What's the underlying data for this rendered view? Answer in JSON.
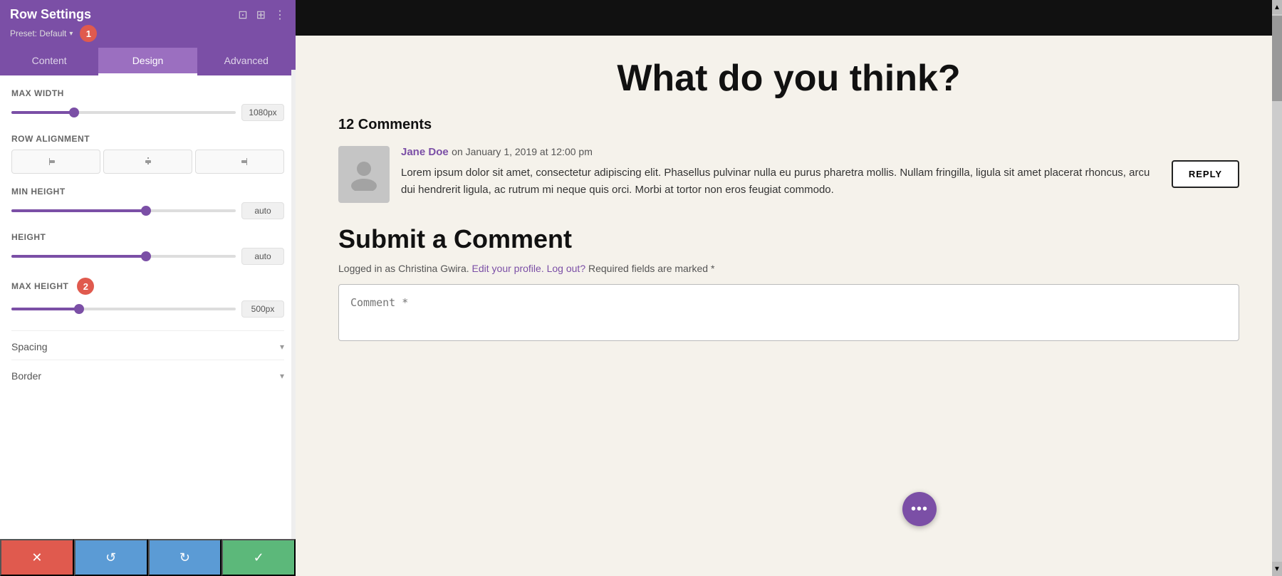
{
  "panel": {
    "title": "Row Settings",
    "preset_label": "Preset: Default",
    "preset_arrow": "▾",
    "badge1": "1",
    "badge2": "2",
    "tabs": [
      {
        "id": "content",
        "label": "Content"
      },
      {
        "id": "design",
        "label": "Design"
      },
      {
        "id": "advanced",
        "label": "Advanced"
      }
    ],
    "active_tab": "design",
    "controls": {
      "max_width": {
        "label": "Max Width",
        "value": "1080px",
        "thumb_pct": 28
      },
      "row_alignment": {
        "label": "Row Alignment",
        "options": [
          "left",
          "center",
          "right"
        ],
        "icons": [
          "⟵·",
          "·|·",
          "·⟶"
        ]
      },
      "min_height": {
        "label": "Min Height",
        "value": "auto",
        "thumb_pct": 60
      },
      "height": {
        "label": "Height",
        "value": "auto",
        "thumb_pct": 60
      },
      "max_height": {
        "label": "Max Height",
        "value": "500px",
        "thumb_pct": 30
      }
    },
    "spacing_label": "Spacing",
    "border_label": "Border",
    "footer": {
      "cancel": "✕",
      "reset": "↺",
      "redo": "↻",
      "save": "✓"
    }
  },
  "content": {
    "page_title": "What do you think?",
    "comments_count": "12 Comments",
    "comment": {
      "author": "Jane Doe",
      "date": "on January 1, 2019 at 12:00 pm",
      "text": "Lorem ipsum dolor sit amet, consectetur adipiscing elit. Phasellus pulvinar nulla eu purus pharetra mollis. Nullam fringilla, ligula sit amet placerat rhoncus, arcu dui hendrerit ligula, ac rutrum mi neque quis orci. Morbi at tortor non eros feugiat commodo.",
      "reply_btn": "REPLY"
    },
    "submit": {
      "title": "Submit a Comment",
      "logged_in_prefix": "Logged in as Christina Gwira.",
      "edit_profile": "Edit your profile.",
      "logout": "Log out?",
      "required": "Required fields are marked *",
      "comment_placeholder": "Comment *"
    }
  }
}
